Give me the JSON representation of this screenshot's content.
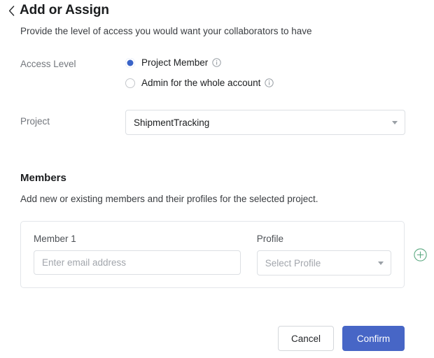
{
  "header": {
    "back_icon": "chevron-left-icon",
    "title": "Add or Assign",
    "subtitle": "Provide the level of access you would want your collaborators to have"
  },
  "access_level": {
    "label": "Access Level",
    "options": [
      {
        "label": "Project Member",
        "selected": true,
        "info_icon": "info-icon"
      },
      {
        "label": "Admin for the whole account",
        "selected": false,
        "info_icon": "info-icon"
      }
    ]
  },
  "project": {
    "label": "Project",
    "value": "ShipmentTracking",
    "caret_icon": "chevron-down-icon"
  },
  "members": {
    "title": "Members",
    "description": "Add new or existing members and their profiles for the selected project.",
    "rows": [
      {
        "member_label": "Member 1",
        "email_value": "",
        "email_placeholder": "Enter email address",
        "profile_label": "Profile",
        "profile_value": "Select Profile",
        "caret_icon": "chevron-down-icon"
      }
    ],
    "add_icon": "plus-circle-icon"
  },
  "footer": {
    "cancel_label": "Cancel",
    "confirm_label": "Confirm"
  },
  "colors": {
    "accent_blue": "#4766c6",
    "radio_blue": "#3a64c8",
    "add_green": "#5aa880",
    "text_primary": "#1b1d1f",
    "text_muted": "#72767c",
    "border": "#dcdfe3"
  }
}
